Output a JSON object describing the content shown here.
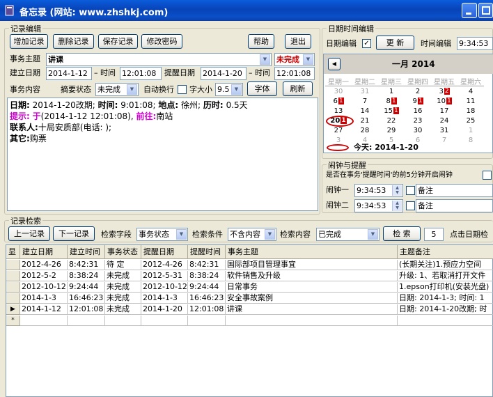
{
  "window": {
    "title": "备忘录 (网站: www.zhshkj.com)"
  },
  "record_edit": {
    "group_title": "记录编辑",
    "buttons": {
      "add": "增加记录",
      "delete": "删除记录",
      "save": "保存记录",
      "change_password": "修改密码",
      "help": "帮助",
      "exit": "退出"
    },
    "subject_label": "事务主题",
    "subject_value": "讲课",
    "status_value": "未完成",
    "created_date_label": "建立日期",
    "created_date_value": "2014-1-12",
    "time_label": "时间",
    "created_time_value": "12:01:08",
    "remind_date_label": "提醒日期",
    "remind_date_value": "2014-1-20",
    "remind_time_value": "12:01:08",
    "content_label": "事务内容",
    "summary_status_label": "摘要状态",
    "summary_status_value": "未完成",
    "auto_wrap_label": "自动换行",
    "font_size_label": "字大小",
    "font_size_value": "9.5",
    "font_button": "字体",
    "refresh_button": "刷新"
  },
  "content": {
    "line1": {
      "k_date": "日期:",
      "v_date": "2014-1-20改期;",
      "k_time": "时间:",
      "v_time": "9:01:08;",
      "k_place": "地点:",
      "v_place": "徐州;",
      "k_duration": "历时:",
      "v_duration": "0.5天"
    },
    "line2": {
      "k_hint": "提示:",
      "k_at": "于",
      "v_when": "(2014-1-12 12:01:08),",
      "k_goto": "前往:",
      "v_dest": "南站"
    },
    "line3": {
      "k_contact": "联系人:",
      "v_contact": "十局安质部(电话: );"
    },
    "line4": {
      "k_other": "其它:",
      "v_other": "购票"
    }
  },
  "datetime_edit": {
    "group_title": "日期时间编辑",
    "date_edit_label": "日期编辑",
    "update_button": "更 新",
    "time_edit_label": "时间编辑",
    "time_edit_value": "9:34:53"
  },
  "calendar": {
    "month_title": "一月 2014",
    "weekdays": [
      "星期一",
      "星期二",
      "星期三",
      "星期四",
      "星期五",
      "星期六"
    ],
    "rows": [
      [
        "30",
        "31",
        "1",
        "2",
        "3",
        "4"
      ],
      [
        "6",
        "7",
        "8",
        "9",
        "10",
        "11"
      ],
      [
        "13",
        "14",
        "15",
        "16",
        "17",
        "18"
      ],
      [
        "20",
        "21",
        "22",
        "23",
        "24",
        "25"
      ],
      [
        "27",
        "28",
        "29",
        "30",
        "31",
        "1"
      ],
      [
        "3",
        "4",
        "5",
        "6",
        "7",
        "8"
      ]
    ],
    "marks": {
      "r0c4": "2",
      "r1c0": "1",
      "r1c2": "1",
      "r1c3": "1",
      "r1c4": "1",
      "r2c2": "1",
      "r3c0": "1"
    },
    "today_label": "今天: 2014-1-20"
  },
  "alarm": {
    "group_title": "闹钟与提醒",
    "question": "是否在事务'提醒时间'的前5分钟开启闹钟",
    "alarm1_label": "闹钟一",
    "alarm1_time": "9:34:53",
    "alarm1_note": "备注",
    "alarm2_label": "闹钟二",
    "alarm2_time": "9:34:53",
    "alarm2_note": "备注"
  },
  "search": {
    "group_title": "记录检索",
    "prev_button": "上一记录",
    "next_button": "下一记录",
    "field_label": "检索字段",
    "field_value": "事务状态",
    "condition_label": "检索条件",
    "condition_value": "不含内容",
    "content_label": "检索内容",
    "content_value": "已完成",
    "search_button": "检 索",
    "count_value": "5",
    "click_hint": "点击日期检"
  },
  "table": {
    "columns": [
      "显",
      "建立日期",
      "建立时间",
      "事务状态",
      "提醒日期",
      "提醒时间",
      "事务主题",
      "主题备注"
    ],
    "rows": [
      [
        "2012-4-26",
        "8:42:31",
        "待  定",
        "2012-4-26",
        "8:42:31",
        "国际部项目管理事宜",
        "(长期关注)1.预应力空间"
      ],
      [
        "2012-5-2",
        "8:38:24",
        "未完成",
        "2012-5-31",
        "8:38:24",
        "软件销售及升级",
        "升级: 1、若取消打开文件"
      ],
      [
        "2012-10-12",
        "9:24:44",
        "未完成",
        "2012-10-12",
        "9:24:44",
        "日常事务",
        "1.epson打印机(安装光盘)"
      ],
      [
        "2014-1-3",
        "16:46:23",
        "未完成",
        "2014-1-3",
        "16:46:23",
        "安全事故案例",
        "日期: 2014-1-3; 时间: 1"
      ],
      [
        "2014-1-12",
        "12:01:08",
        "未完成",
        "2014-1-20",
        "12:01:08",
        "讲课",
        "日期: 2014-1-20改期; 时"
      ]
    ],
    "new_row_marker": "*"
  },
  "colors": {
    "titlebar": "#0a4fc8",
    "accent_red": "#cc0000",
    "label_blue": "#0000cc",
    "label_purple": "#cc00cc"
  }
}
